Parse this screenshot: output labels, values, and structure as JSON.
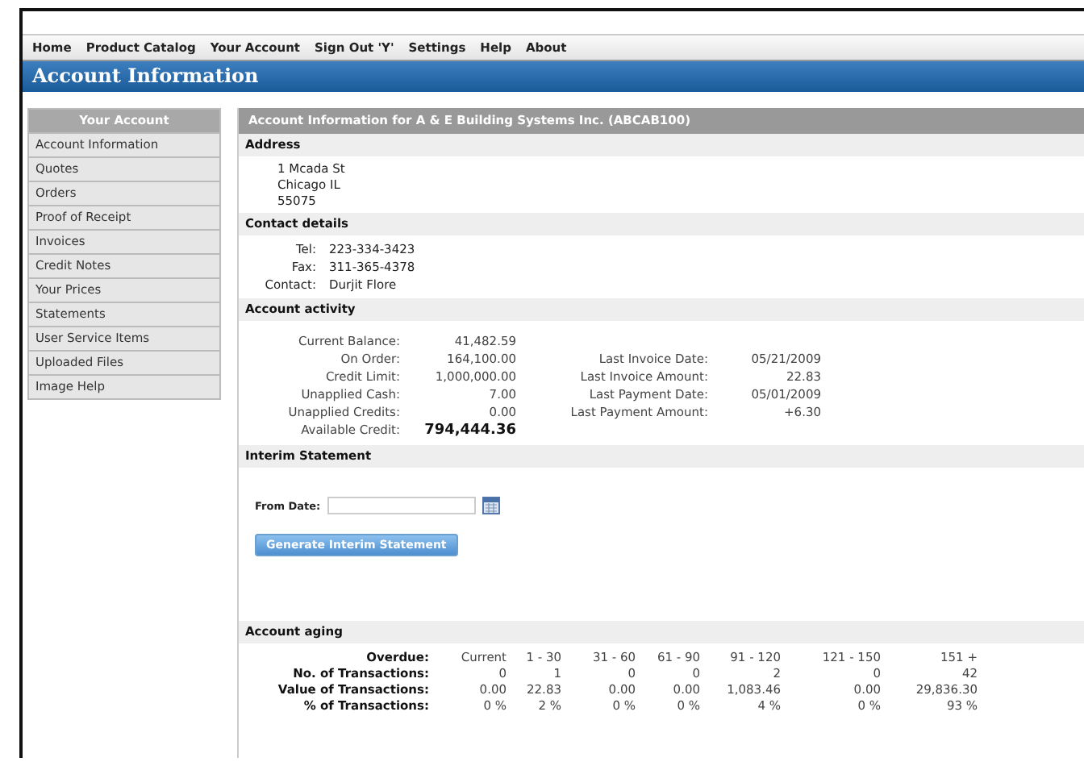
{
  "menu": [
    "Home",
    "Product Catalog",
    "Your Account",
    "Sign Out 'Y'",
    "Settings",
    "Help",
    "About"
  ],
  "page_title": "Account Information",
  "sidebar": {
    "title": "Your Account",
    "items": [
      "Account Information",
      "Quotes",
      "Orders",
      "Proof of Receipt",
      "Invoices",
      "Credit Notes",
      "Your Prices",
      "Statements",
      "User Service Items",
      "Uploaded Files",
      "Image Help"
    ]
  },
  "panel_title": "Account Information for A & E Building Systems Inc. (ABCAB100)",
  "address": {
    "heading": "Address",
    "lines": [
      "1 Mcada St",
      "Chicago IL",
      "55075"
    ]
  },
  "contact": {
    "heading": "Contact details",
    "rows": [
      {
        "label": "Tel:",
        "value": "223-334-3423"
      },
      {
        "label": "Fax:",
        "value": "311-365-4378"
      },
      {
        "label": "Contact:",
        "value": "Durjit Flore"
      }
    ]
  },
  "activity": {
    "heading": "Account activity",
    "left": [
      {
        "label": "Current Balance:",
        "value": "41,482.59"
      },
      {
        "label": "On Order:",
        "value": "164,100.00"
      },
      {
        "label": "Credit Limit:",
        "value": "1,000,000.00"
      },
      {
        "label": "Unapplied Cash:",
        "value": "7.00"
      },
      {
        "label": "Unapplied Credits:",
        "value": "0.00"
      },
      {
        "label": "Available Credit:",
        "value": "794,444.36",
        "bold": true
      }
    ],
    "right": [
      {
        "label": "Last Invoice Date:",
        "value": "05/21/2009"
      },
      {
        "label": "Last Invoice Amount:",
        "value": "22.83"
      },
      {
        "label": "Last Payment Date:",
        "value": "05/01/2009"
      },
      {
        "label": "Last Payment Amount:",
        "value": "+6.30"
      }
    ]
  },
  "interim": {
    "heading": "Interim Statement",
    "from_label": "From Date:",
    "button": "Generate Interim Statement"
  },
  "aging": {
    "heading": "Account aging",
    "rows": [
      {
        "label": "Overdue:",
        "cells": [
          "Current",
          "1 - 30",
          "31 - 60",
          "61 - 90",
          "91 - 120",
          "121 - 150",
          "151 +"
        ]
      },
      {
        "label": "No. of Transactions:",
        "cells": [
          "0",
          "1",
          "0",
          "0",
          "2",
          "0",
          "42"
        ]
      },
      {
        "label": "Value of Transactions:",
        "cells": [
          "0.00",
          "22.83",
          "0.00",
          "0.00",
          "1,083.46",
          "0.00",
          "29,836.30"
        ]
      },
      {
        "label": "% of Transactions:",
        "cells": [
          "0 %",
          "2 %",
          "0 %",
          "0 %",
          "4 %",
          "0 %",
          "93 %"
        ]
      }
    ]
  }
}
